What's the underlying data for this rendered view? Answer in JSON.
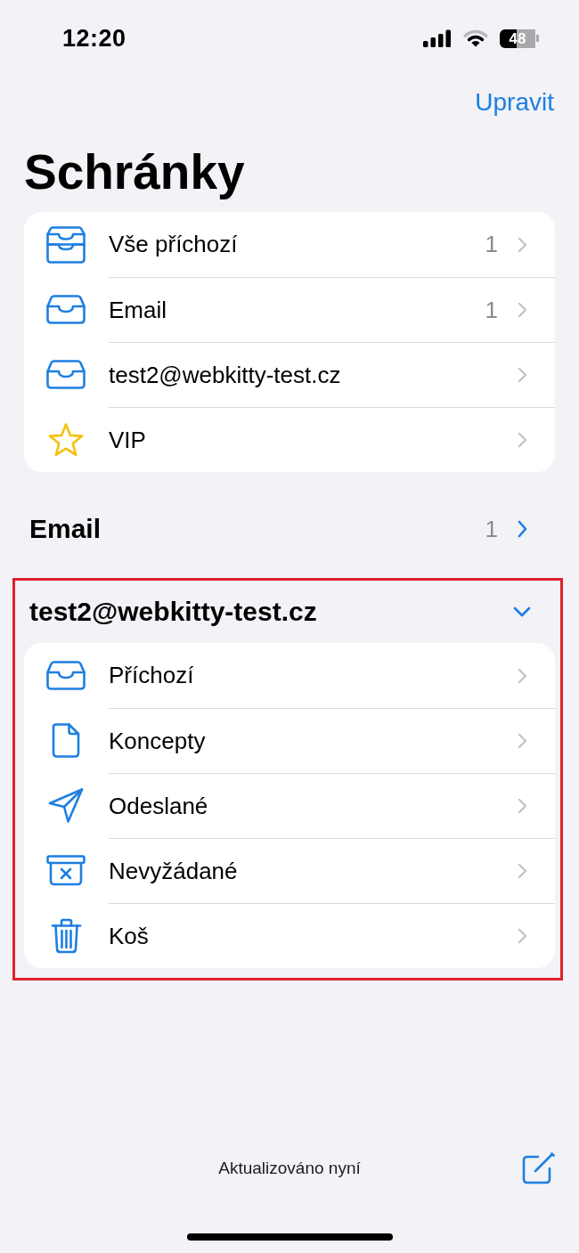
{
  "status_bar": {
    "time": "12:20",
    "battery": "48"
  },
  "nav": {
    "edit_button": "Upravit"
  },
  "title": "Schránky",
  "mailboxes": [
    {
      "kind": "all_inboxes",
      "label": "Vše příchozí",
      "count": "1"
    },
    {
      "kind": "inbox",
      "label": "Email",
      "count": "1"
    },
    {
      "kind": "inbox",
      "label": "test2@webkitty-test.cz"
    },
    {
      "kind": "vip",
      "label": "VIP"
    }
  ],
  "accounts": [
    {
      "name": "Email",
      "count": "1",
      "expanded": false,
      "highlighted": false
    },
    {
      "name": "test2@webkitty-test.cz",
      "expanded": true,
      "highlighted": true,
      "folders": [
        {
          "kind": "inbox",
          "label": "Příchozí"
        },
        {
          "kind": "drafts",
          "label": "Koncepty"
        },
        {
          "kind": "sent",
          "label": "Odeslané"
        },
        {
          "kind": "junk",
          "label": "Nevyžádané"
        },
        {
          "kind": "trash",
          "label": "Koš"
        }
      ]
    }
  ],
  "toolbar": {
    "status": "Aktualizováno nyní"
  }
}
